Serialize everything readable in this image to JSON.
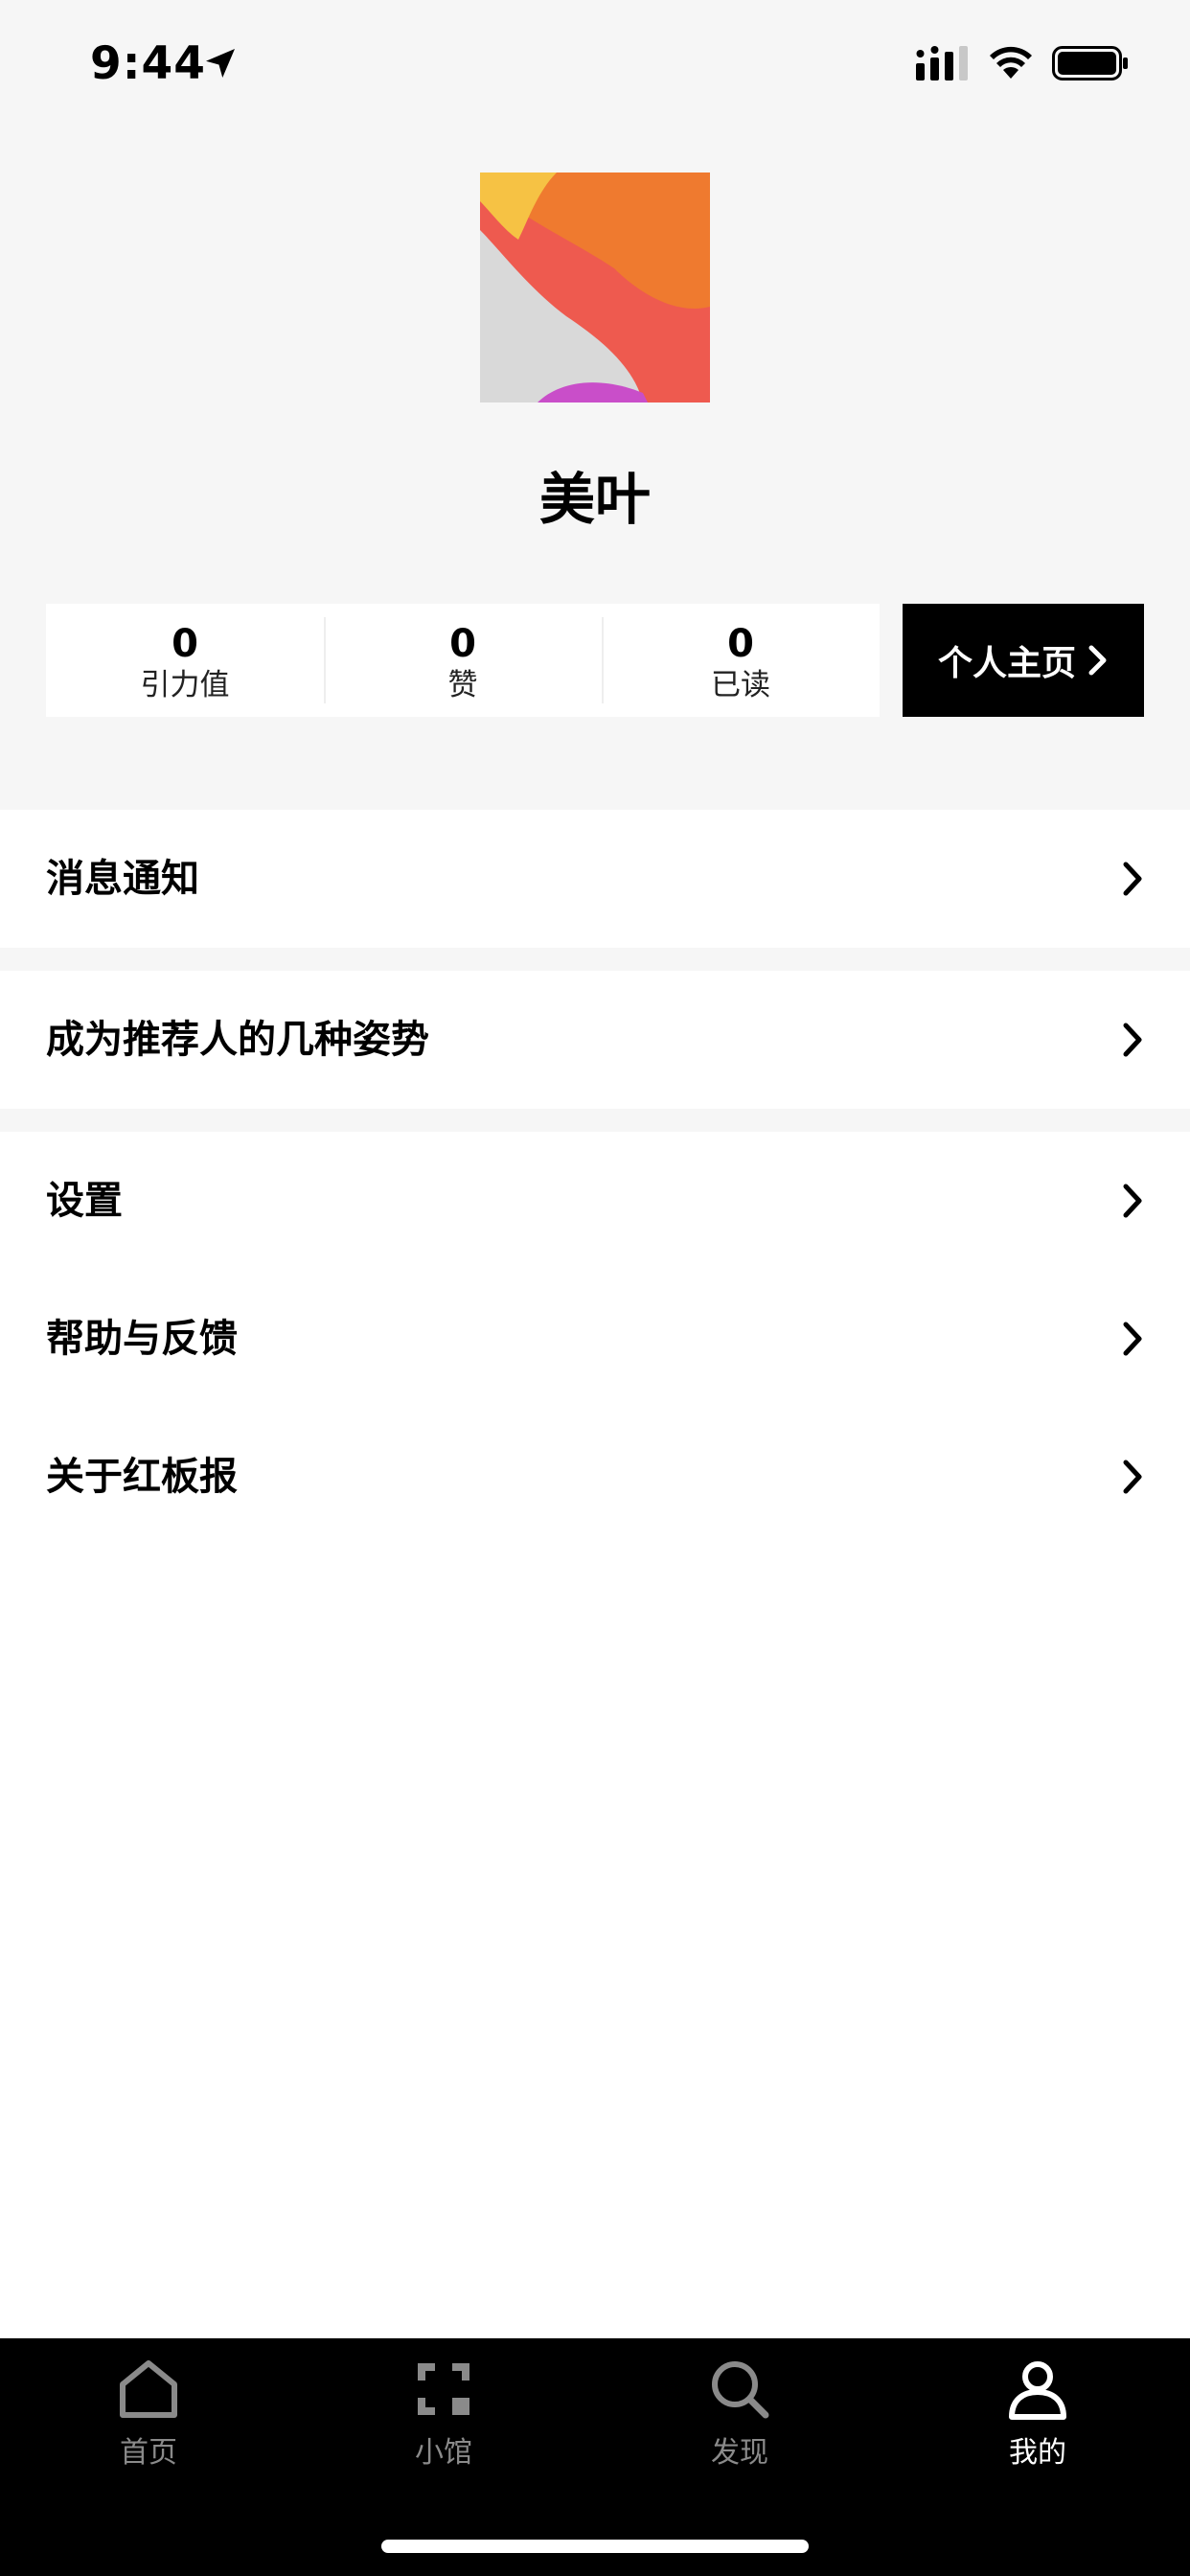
{
  "status_bar": {
    "time": "9:44"
  },
  "profile": {
    "username": "美叶",
    "stats": [
      {
        "value": "0",
        "label": "引力值"
      },
      {
        "value": "0",
        "label": "赞"
      },
      {
        "value": "0",
        "label": "已读"
      }
    ],
    "homepage_button": "个人主页"
  },
  "menu": {
    "notifications": "消息通知",
    "recommender_tips": "成为推荐人的几种姿势",
    "settings": "设置",
    "help_feedback": "帮助与反馈",
    "about": "关于红板报"
  },
  "tabbar": {
    "items": [
      {
        "label": "首页",
        "icon": "home-icon"
      },
      {
        "label": "小馆",
        "icon": "frame-icon"
      },
      {
        "label": "发现",
        "icon": "search-icon"
      },
      {
        "label": "我的",
        "icon": "user-icon"
      }
    ],
    "active": "我的"
  },
  "colors": {
    "background_gray": "#f6f6f6",
    "tabbar_bg": "#000000",
    "tab_inactive": "#8a8a8a",
    "tab_active": "#ffffff"
  }
}
